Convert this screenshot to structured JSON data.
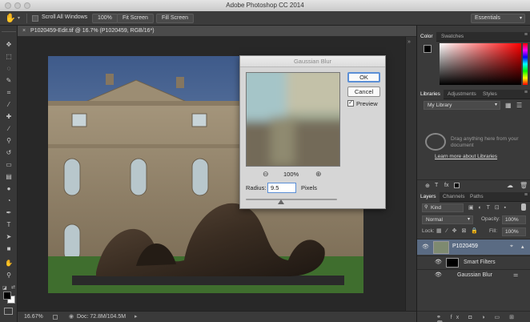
{
  "app": {
    "title": "Adobe Photoshop CC 2014"
  },
  "options_bar": {
    "scroll_all_windows": "Scroll All Windows",
    "zoom_100": "100%",
    "fit_screen": "Fit Screen",
    "fill_screen": "Fill Screen",
    "workspace": "Essentials"
  },
  "document": {
    "tab_title": "P1020459-Edit.tif @ 16.7% (P1020459, RGB/16*)",
    "close_glyph": "×"
  },
  "status": {
    "zoom": "16.67%",
    "doc_info": "Doc: 72.8M/104.5M"
  },
  "dialog": {
    "title": "Gaussian Blur",
    "ok": "OK",
    "cancel": "Cancel",
    "preview_label": "Preview",
    "preview_checked": true,
    "zoom_level": "100%",
    "radius_label": "Radius:",
    "radius_value": "9.5",
    "radius_unit": "Pixels"
  },
  "panels": {
    "color_tabs": [
      "Color",
      "Swatches"
    ],
    "libraries_tabs": [
      "Libraries",
      "Adjustments",
      "Styles"
    ],
    "library_selected": "My Library",
    "libraries_hint": "Drag anything here from your document",
    "libraries_link": "Learn more about Libraries",
    "layers_tabs": [
      "Layers",
      "Channels",
      "Paths"
    ],
    "layer_filter": "Kind",
    "blend_mode": "Normal",
    "opacity_label": "Opacity:",
    "opacity_value": "100%",
    "lock_label": "Lock:",
    "fill_label": "Fill:",
    "fill_value": "100%",
    "layers": [
      {
        "name": "P1020459"
      },
      {
        "name": "Smart Filters"
      },
      {
        "name": "Gaussian Blur"
      }
    ]
  },
  "colors": {
    "foreground": "#000000",
    "background": "#ffffff",
    "accent": "#5b8fd6"
  }
}
